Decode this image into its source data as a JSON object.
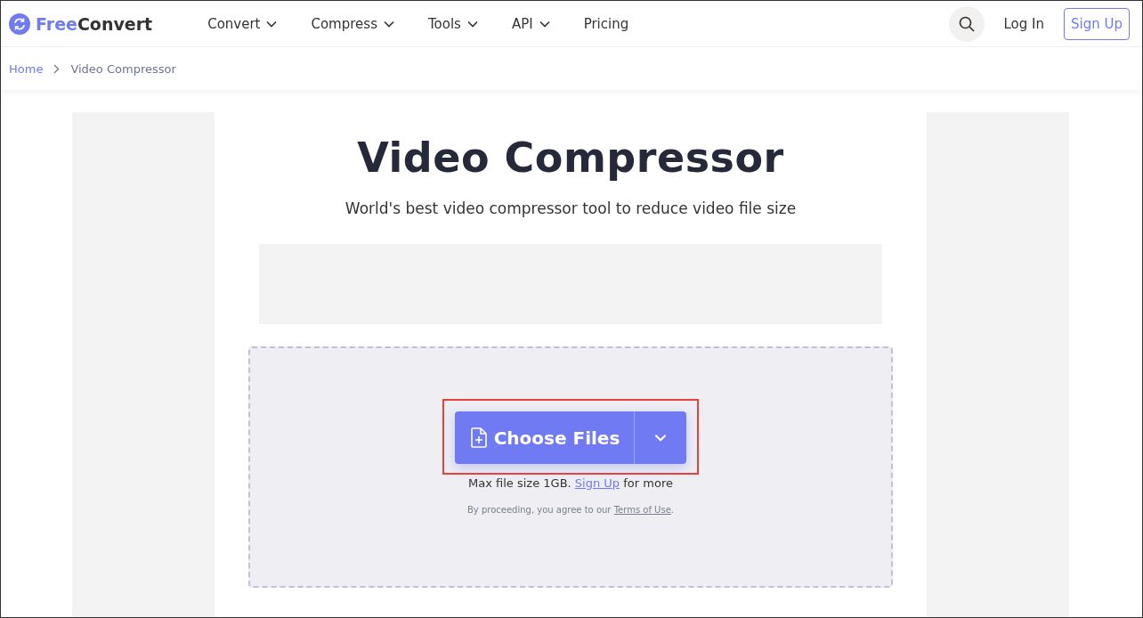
{
  "header": {
    "logo": {
      "brand_first": "Free",
      "brand_second": "Convert"
    },
    "nav": [
      {
        "label": "Convert",
        "dropdown": true
      },
      {
        "label": "Compress",
        "dropdown": true
      },
      {
        "label": "Tools",
        "dropdown": true
      },
      {
        "label": "API",
        "dropdown": true
      },
      {
        "label": "Pricing",
        "dropdown": false
      }
    ],
    "login": "Log In",
    "signup": "Sign Up"
  },
  "breadcrumb": [
    "Home",
    "Video Compressor"
  ],
  "main": {
    "title": "Video Compressor",
    "subtitle": "World's best video compressor tool to reduce video file size",
    "upload": {
      "button": "Choose Files",
      "highlighted": true,
      "limit": {
        "before": "Max file size 1GB. ",
        "link": "Sign Up",
        "after": " for more"
      },
      "terms": {
        "before": "By proceeding, you agree to our ",
        "link": "Terms of Use",
        "after": "."
      }
    }
  }
}
